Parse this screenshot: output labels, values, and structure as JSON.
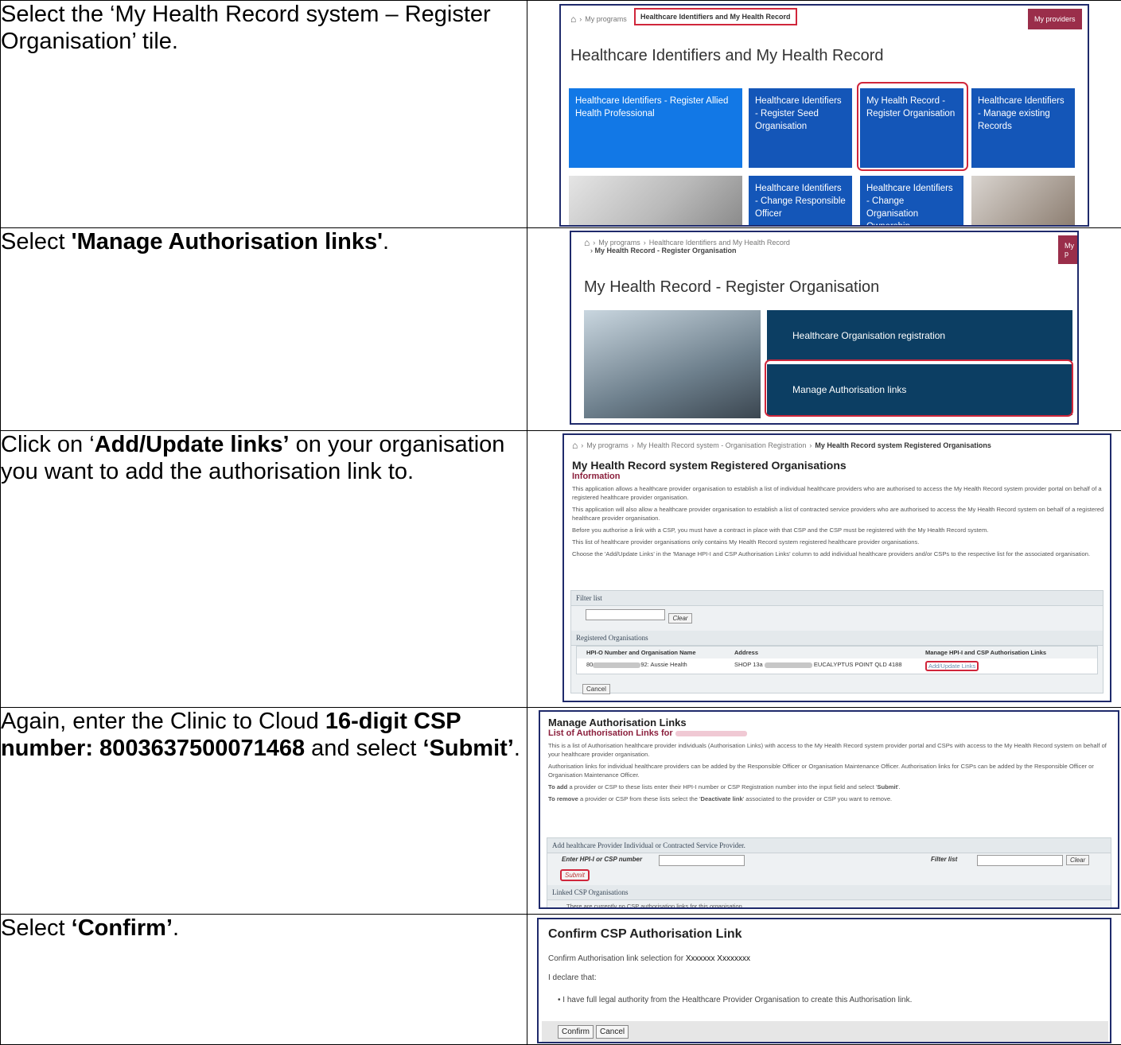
{
  "steps": [
    {
      "instruction": [
        "Select the ‘My Health Record system – Register Organisation’ tile."
      ]
    },
    {
      "instruction": [
        "Select ",
        "'Manage Authorisation links'",
        "."
      ]
    },
    {
      "instruction": [
        "Click on ‘",
        "Add/Update links’",
        " on your organisation you want to add the authorisation link to."
      ]
    },
    {
      "instruction": [
        "Again, enter the Clinic to Cloud ",
        "16-digit CSP number: 8003637500071468",
        " and select ",
        "‘Submit’",
        "."
      ]
    },
    {
      "instruction": [
        "Select ",
        "‘Confirm’",
        "."
      ]
    }
  ],
  "shot1": {
    "breadcrumb": [
      "My programs",
      "Healthcare Identifiers and My Health Record"
    ],
    "my_providers": "My providers",
    "title": "Healthcare Identifiers and My Health Record",
    "tiles": [
      "Healthcare Identifiers - Register Allied Health Professional",
      "Healthcare Identifiers - Register Seed Organisation",
      "My Health Record - Register Organisation",
      "Healthcare Identifiers - Manage existing Records",
      "Healthcare Identifiers - Change Responsible Officer",
      "Healthcare Identifiers - Change Organisation Ownership"
    ]
  },
  "shot2": {
    "breadcrumb": [
      "My programs",
      "Healthcare Identifiers and My Health Record",
      "My Health Record - Register Organisation"
    ],
    "my_providers": "My p",
    "title": "My Health Record - Register Organisation",
    "options": [
      "Healthcare Organisation registration",
      "Manage Authorisation links"
    ]
  },
  "shot3": {
    "breadcrumb": [
      "My programs",
      "My Health Record system - Organisation Registration",
      "My Health Record system Registered Organisations"
    ],
    "title": "My Health Record system Registered Organisations",
    "info_heading": "Information",
    "paragraphs": [
      "This application allows a healthcare provider organisation to establish a list of individual healthcare providers who are authorised to access the My Health Record system provider portal on behalf of a registered healthcare provider organisation.",
      "This application will also allow a healthcare provider organisation to establish a list of contracted service providers who are authorised to access the My Health Record system on behalf of a registered healthcare provider organisation.",
      "Before you authorise a link with a CSP, you must have a contract in place with that CSP and the CSP must be registered with the My Health Record system.",
      "This list of healthcare provider organisations only contains My Health Record system registered healthcare provider organisations.",
      "Choose the 'Add/Update Links' in the 'Manage HPI-I and CSP Authorisation Links' column to add individual healthcare providers and/or CSPs to the respective list for the associated organisation."
    ],
    "filter_heading": "Filter list",
    "clear_label": "Clear",
    "registered_heading": "Registered Organisations",
    "columns": [
      "HPI-O Number and Organisation Name",
      "Address",
      "Manage HPI-I and CSP Authorisation Links"
    ],
    "row": {
      "hpio_start": "80",
      "hpio_end": "92: Aussie Health",
      "address_start": "SHOP 13a",
      "address_end": "EUCALYPTUS POINT QLD 4188",
      "link": "Add/Update Links"
    },
    "cancel_label": "Cancel"
  },
  "shot4": {
    "title": "Manage Authorisation Links",
    "subtitle": "List of Authorisation Links for",
    "paragraphs": [
      "This is a list of Authorisation healthcare provider individuals (Authorisation Links) with access to the My Health Record system provider portal and CSPs with access to the My Health Record system on behalf of your healthcare provider organisation.",
      "Authorisation links for individual healthcare providers can be added by the Responsible Officer or Organisation Maintenance Officer. Authorisation links for CSPs can be added by the Responsible Officer or Organisation Maintenance Officer."
    ],
    "add_note": [
      "To add",
      " a provider or CSP to these lists enter their HPI-I number or CSP Registration number into the input field and select '",
      "Submit",
      "'."
    ],
    "remove_note": [
      "To remove",
      " a provider or CSP from these lists select the '",
      "Deactivate link",
      "' associated to the provider or CSP you want to remove."
    ],
    "add_heading": "Add healthcare Provider Individual or Contracted Service Provider.",
    "enter_label": "Enter HPI-I or CSP number",
    "filter_label": "Filter list",
    "clear_label": "Clear",
    "submit_label": "Submit",
    "linked_heading": "Linked CSP Organisations",
    "linked_empty": "There are currently no CSP authorisation links for this organisation."
  },
  "shot5": {
    "title": "Confirm CSP Authorisation Link",
    "selection_text": "Confirm Authorisation link selection for",
    "selection_name": "Xxxxxxx Xxxxxxxx",
    "declare": "I declare that:",
    "bullet": "I have full legal authority from the Healthcare Provider Organisation to create this Authorisation link.",
    "confirm_label": "Confirm",
    "cancel_label": "Cancel"
  },
  "colors": {
    "tile_light_blue": "#1278e6",
    "tile_dark_blue": "#1456b8",
    "navy": "#0c3e63",
    "highlight_red": "#d0263b",
    "maroon": "#9a2e4a"
  }
}
